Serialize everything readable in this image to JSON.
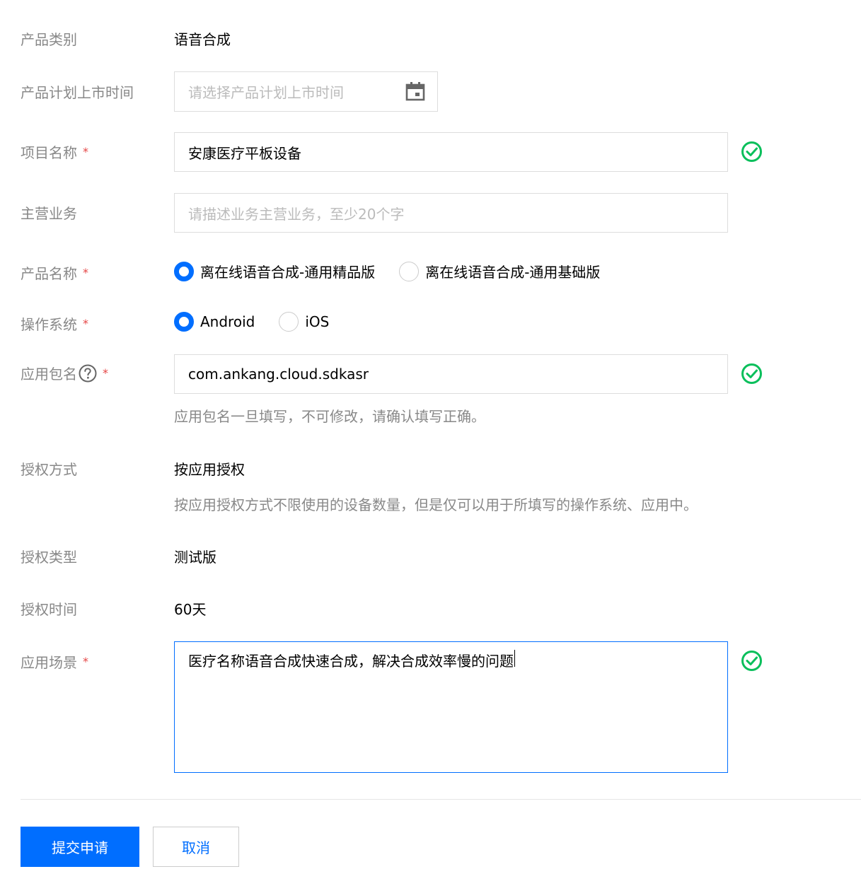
{
  "form": {
    "product_category": {
      "label": "产品类别",
      "value": "语音合成"
    },
    "launch_time": {
      "label": "产品计划上市时间",
      "placeholder": "请选择产品计划上市时间"
    },
    "project_name": {
      "label": "项目名称",
      "value": "安康医疗平板设备"
    },
    "main_business": {
      "label": "主营业务",
      "placeholder": "请描述业务主营业务，至少20个字"
    },
    "product_name": {
      "label": "产品名称",
      "options": [
        "离在线语音合成-通用精品版",
        "离在线语音合成-通用基础版"
      ],
      "selected": "离在线语音合成-通用精品版"
    },
    "os": {
      "label": "操作系统",
      "options": [
        "Android",
        "iOS"
      ],
      "selected": "Android"
    },
    "package_name": {
      "label": "应用包名",
      "value": "com.ankang.cloud.sdkasr",
      "hint": "应用包名一旦填写，不可修改，请确认填写正确。"
    },
    "auth_method": {
      "label": "授权方式",
      "value": "按应用授权",
      "hint": "按应用授权方式不限使用的设备数量，但是仅可以用于所填写的操作系统、应用中。"
    },
    "auth_type": {
      "label": "授权类型",
      "value": "测试版"
    },
    "auth_time": {
      "label": "授权时间",
      "value": "60天"
    },
    "scenario": {
      "label": "应用场景",
      "value": "医疗名称语音合成快速合成，解决合成效率慢的问题"
    },
    "required_mark": "*"
  },
  "actions": {
    "submit_label": "提交申请",
    "cancel_label": "取消"
  },
  "icons": {
    "calendar": "calendar-icon",
    "valid": "check-circle-icon",
    "help": "question-circle-icon"
  },
  "colors": {
    "primary": "#006eff",
    "success": "#0abf5b",
    "required": "#e54545",
    "label": "#888888"
  }
}
